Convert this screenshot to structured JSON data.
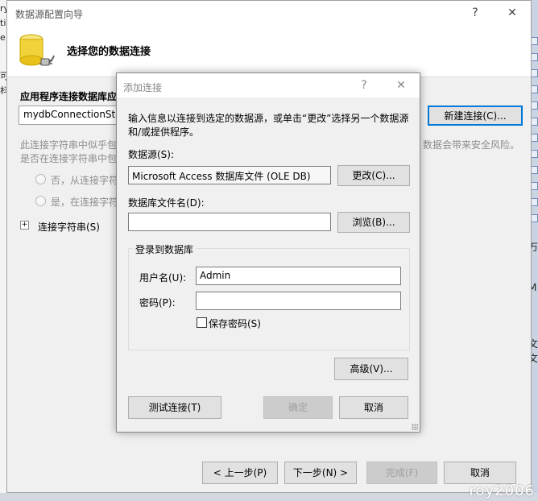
{
  "wizard": {
    "title": "数据源配置向导",
    "help": "?",
    "close": "✕",
    "header_title": "选择您的数据连接",
    "section_label": "应用程序连接数据库应",
    "connection_value": "mydbConnectionStri",
    "new_connection": "新建连接(C)...",
    "warning_line1": "此连接字符串中似乎包",
    "warning_line2": "是否在连接字符串中包",
    "warning_right": "数据会带来安全风险。",
    "radio_no": "否，从连接字符",
    "radio_yes": "是，在连接字符",
    "expander_sign": "+",
    "conn_string_label": "连接字符串(S)",
    "prev": "< 上一步(P)",
    "next": "下一步(N) >",
    "finish": "完成(F)",
    "cancel": "取消"
  },
  "dialog": {
    "title": "添加连接",
    "help": "?",
    "close": "✕",
    "instructions": "输入信息以连接到选定的数据源，或单击“更改”选择另一个数据源和/或提供程序。",
    "datasource_label": "数据源(S):",
    "datasource_value": "Microsoft Access 数据库文件 (OLE DB)",
    "change": "更改(C)...",
    "dbfile_label": "数据库文件名(D):",
    "dbfile_value": "",
    "browse": "浏览(B)...",
    "login_group": "登录到数据库",
    "username_label": "用户名(U):",
    "username_value": "Admin",
    "password_label": "密码(P):",
    "password_value": "",
    "save_password": "保存密码(S)",
    "advanced": "高级(V)...",
    "test": "测试连接(T)",
    "ok": "确定",
    "cancel": "取消"
  },
  "background": {
    "left_fragments": [
      "ry",
      "ti",
      "e:",
      "可",
      "枓"
    ],
    "right_fragments": [
      "万",
      "M",
      "文",
      "文"
    ],
    "watermark": "roy2006"
  },
  "colors": {
    "accent": "#0078d7",
    "dialog_bg": "#f0f0f0",
    "button_bg": "#e1e1e1"
  }
}
